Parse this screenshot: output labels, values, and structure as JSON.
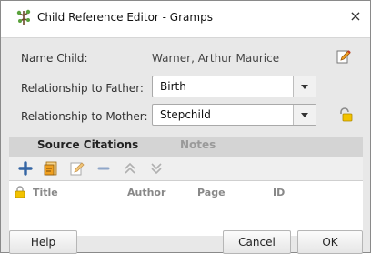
{
  "window": {
    "title": "Child Reference Editor - Gramps",
    "close_label": "×"
  },
  "form": {
    "name_label": "Name Child:",
    "name_value": "Warner, Arthur Maurice",
    "father_label": "Relationship to Father:",
    "father_value": "Birth",
    "mother_label": "Relationship to Mother:",
    "mother_value": "Stepchild"
  },
  "tabs": [
    {
      "label": "Source Citations",
      "active": true
    },
    {
      "label": "Notes",
      "active": false
    }
  ],
  "toolbar": {
    "icons": [
      "add-icon",
      "share-existing-icon",
      "edit-icon",
      "remove-icon",
      "move-up-icon",
      "move-down-icon"
    ]
  },
  "table": {
    "columns": [
      "Title",
      "Author",
      "Page",
      "ID"
    ],
    "lock_icon": "private-lock-icon"
  },
  "buttons": {
    "help": "Help",
    "cancel": "Cancel",
    "ok": "OK"
  },
  "colors": {
    "accent_blue": "#3465a4",
    "tab_bar": "#d4d4d4",
    "window_bg": "#e8e8e8"
  }
}
